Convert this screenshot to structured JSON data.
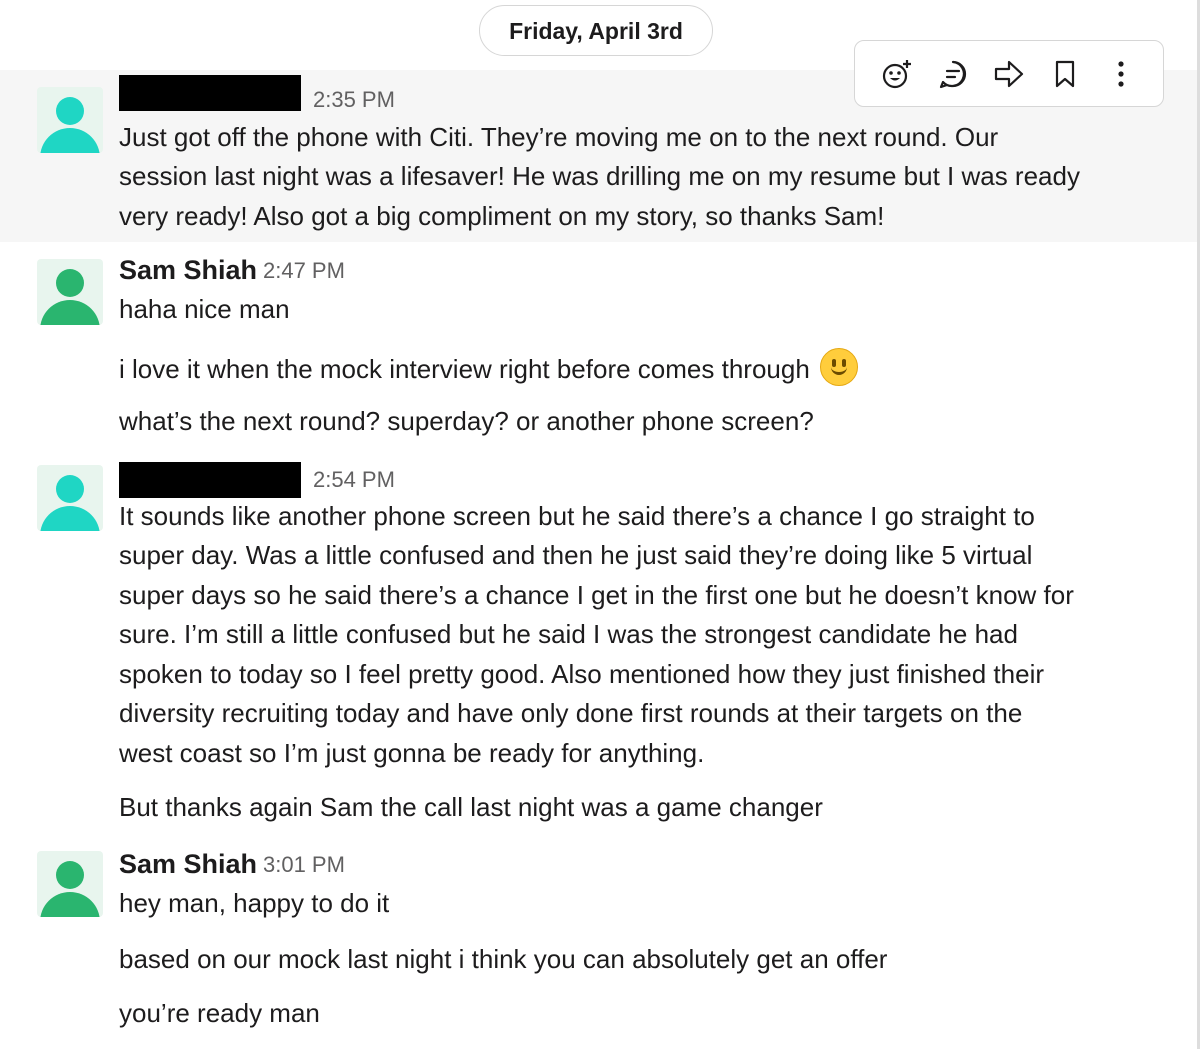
{
  "date_divider": "Friday, April 3rd",
  "toolbar": {
    "icons": [
      "add-reaction-icon",
      "reply-in-thread-icon",
      "share-message-icon",
      "save-bookmark-icon",
      "more-actions-icon"
    ]
  },
  "colors": {
    "avatar_redacted_user": "#1fd6c4",
    "avatar_sam": "#2ab56f",
    "avatar_bg": "#e8f5ee",
    "hover_bg": "#f6f6f6",
    "emoji": "#ffcd3c"
  },
  "messages": [
    {
      "sender": "",
      "time": "2:35 PM",
      "lines": [
        "Just got off the phone with Citi. They’re moving me on to the next round. Our",
        "session last night was a lifesaver! He was drilling me on my resume but I was ready",
        "very ready! Also got a big compliment on my story, so thanks Sam!"
      ]
    },
    {
      "sender": "Sam Shiah",
      "time": "2:47 PM",
      "lines": [
        "haha nice man",
        "i love it when the mock interview right before comes through",
        "what’s the next round? superday? or another phone screen?"
      ],
      "emoji": "slightly-smiling-face-emoji"
    },
    {
      "sender": "",
      "time": "2:54 PM",
      "lines": [
        "It sounds like another phone screen but he said there’s a chance I go straight to",
        "super day. Was a little confused and then he just said they’re doing like 5 virtual",
        "super days so he said there’s a chance I get in the first one but he doesn’t know for",
        "sure. I’m still a little confused but he said I was the strongest candidate he had",
        "spoken to today so I feel pretty good. Also mentioned how they just finished their",
        "diversity recruiting today and have only done first rounds at their targets on the",
        "west coast so I’m just gonna be ready for anything.",
        "But thanks again Sam the call last night was a game changer"
      ]
    },
    {
      "sender": "Sam Shiah",
      "time": "3:01 PM",
      "lines": [
        "hey man, happy to do it",
        "based on our mock last night i think you can absolutely get an offer",
        "you’re ready man"
      ]
    }
  ]
}
